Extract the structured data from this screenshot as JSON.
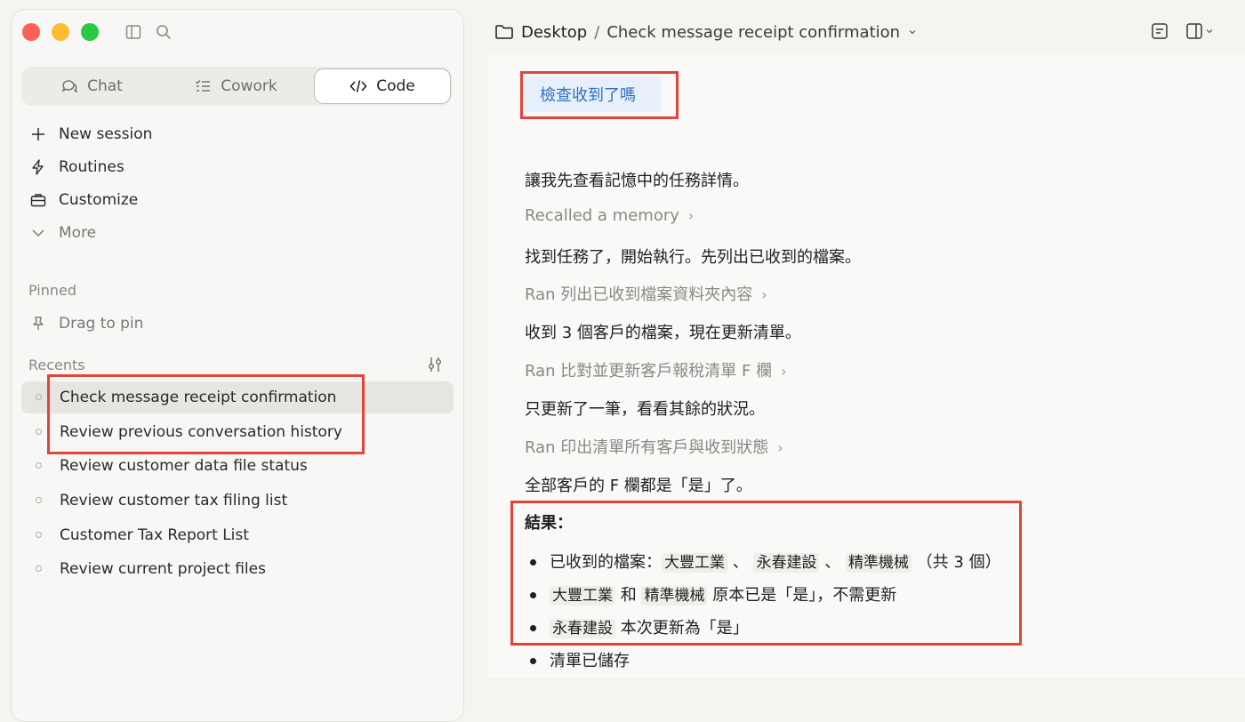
{
  "window_controls": [
    "close",
    "minimize",
    "zoom"
  ],
  "mode_tabs": [
    {
      "label": "Chat",
      "icon": "chat-icon"
    },
    {
      "label": "Cowork",
      "icon": "checklist-icon"
    },
    {
      "label": "Code",
      "icon": "code-icon",
      "selected": true
    }
  ],
  "nav": [
    {
      "label": "New session",
      "icon": "plus-icon"
    },
    {
      "label": "Routines",
      "icon": "bolt-icon"
    },
    {
      "label": "Customize",
      "icon": "briefcase-icon"
    },
    {
      "label": "More",
      "icon": "chevron-down-icon"
    }
  ],
  "pinned": {
    "heading": "Pinned",
    "placeholder": "Drag to pin"
  },
  "recents": {
    "heading": "Recents",
    "items": [
      {
        "label": "Check message receipt confirmation",
        "active": true
      },
      {
        "label": "Review previous conversation history"
      },
      {
        "label": "Review customer data file status"
      },
      {
        "label": "Review customer tax filing list"
      },
      {
        "label": "Customer Tax Report List"
      },
      {
        "label": "Review current project files"
      }
    ]
  },
  "breadcrumb": {
    "root": "Desktop",
    "separator": "/",
    "title": "Check message receipt confirmation"
  },
  "conversation": {
    "user_message": "檢查收到了嗎",
    "line1": "讓我先查看記憶中的任務詳情。",
    "tool1": "Recalled a memory",
    "line2": "找到任務了，開始執行。先列出已收到的檔案。",
    "tool2": "Ran 列出已收到檔案資料夾內容",
    "line3": "收到 3 個客戶的檔案，現在更新清單。",
    "tool3": "Ran 比對並更新客戶報稅清單 F 欄",
    "line4": "只更新了一筆，看看其餘的狀況。",
    "tool4": "Ran 印出清單所有客戶與收到狀態",
    "line5": "全部客戶的 F 欄都是「是」了。",
    "result_heading": "結果：",
    "bullet1": {
      "prefix": "已收到的檔案：",
      "codes": [
        "大豐工業",
        "永春建設",
        "精準機械"
      ],
      "sep": "、",
      "suffix": "（共 3 個）"
    },
    "bullet2": {
      "code1": "大豐工業",
      "mid": "和",
      "code2": "精準機械",
      "suffix": "原本已是「是」，不需更新"
    },
    "bullet3": {
      "code": "永春建設",
      "suffix": "本次更新為「是」"
    },
    "bullet4": "清單已儲存",
    "tool_chevron": "›"
  },
  "colors": {
    "highlight_box": "#e0453a",
    "user_bubble_bg": "#e7f0fa",
    "user_text": "#2f6fbd"
  }
}
